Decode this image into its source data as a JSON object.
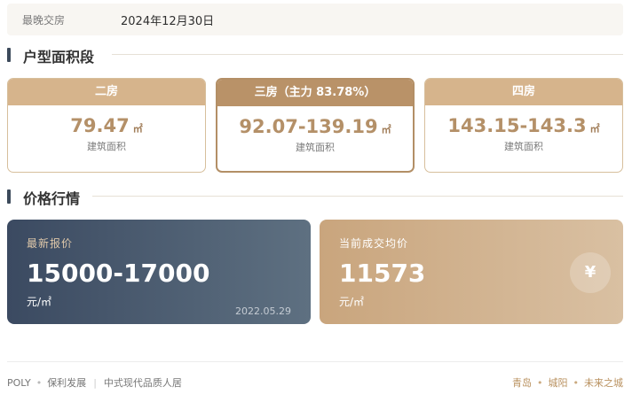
{
  "info": {
    "label": "最晚交房",
    "value": "2024年12月30日"
  },
  "sections": {
    "units_title": "户型面积段",
    "price_title": "价格行情"
  },
  "units": [
    {
      "name": "二房",
      "area": "79.47",
      "unit": "㎡",
      "sub": "建筑面积"
    },
    {
      "name": "三房（主力 83.78%）",
      "area": "92.07-139.19",
      "unit": "㎡",
      "sub": "建筑面积"
    },
    {
      "name": "四房",
      "area": "143.15-143.3",
      "unit": "㎡",
      "sub": "建筑面积"
    }
  ],
  "price": {
    "latest": {
      "label": "最新报价",
      "value": "15000-17000",
      "unit": "元/㎡",
      "date": "2022.05.29"
    },
    "average": {
      "label": "当前成交均价",
      "value": "11573",
      "unit": "元/㎡",
      "badge": "¥"
    }
  },
  "footer": {
    "brand": "POLY",
    "dot": "•",
    "company": "保利发展",
    "sep": "|",
    "slogan": "中式现代品质人居",
    "city": "青岛",
    "district": "城阳",
    "tagline": "未来之城"
  },
  "colors": {
    "accent_gold": "#b49068",
    "dark_card": "#3b4a61",
    "section_bar": "#3c4a5b"
  }
}
